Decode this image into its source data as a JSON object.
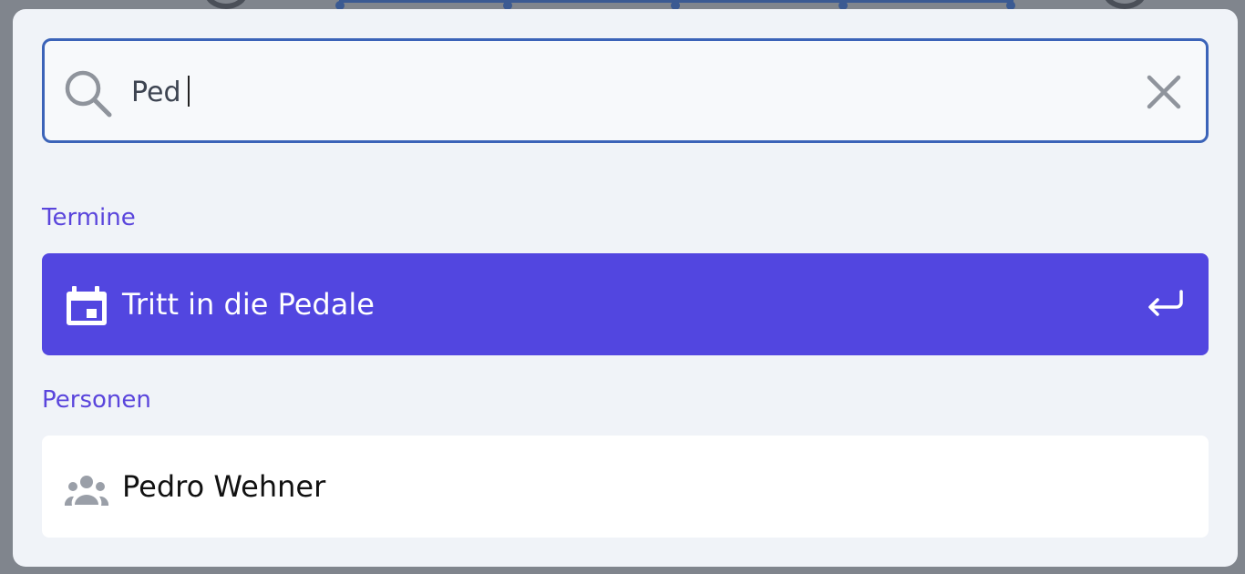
{
  "search": {
    "value": "Ped"
  },
  "sections": [
    {
      "label": "Termine",
      "items": [
        {
          "label": "Tritt in die Pedale",
          "icon": "calendar-icon",
          "active": true
        }
      ]
    },
    {
      "label": "Personen",
      "items": [
        {
          "label": "Pedro Wehner",
          "icon": "people-icon",
          "active": false
        }
      ]
    }
  ],
  "colors": {
    "accent": "#5246e0",
    "section_label": "#5a45dc",
    "input_border": "#3b63b8",
    "modal_bg": "#f0f3f8"
  }
}
